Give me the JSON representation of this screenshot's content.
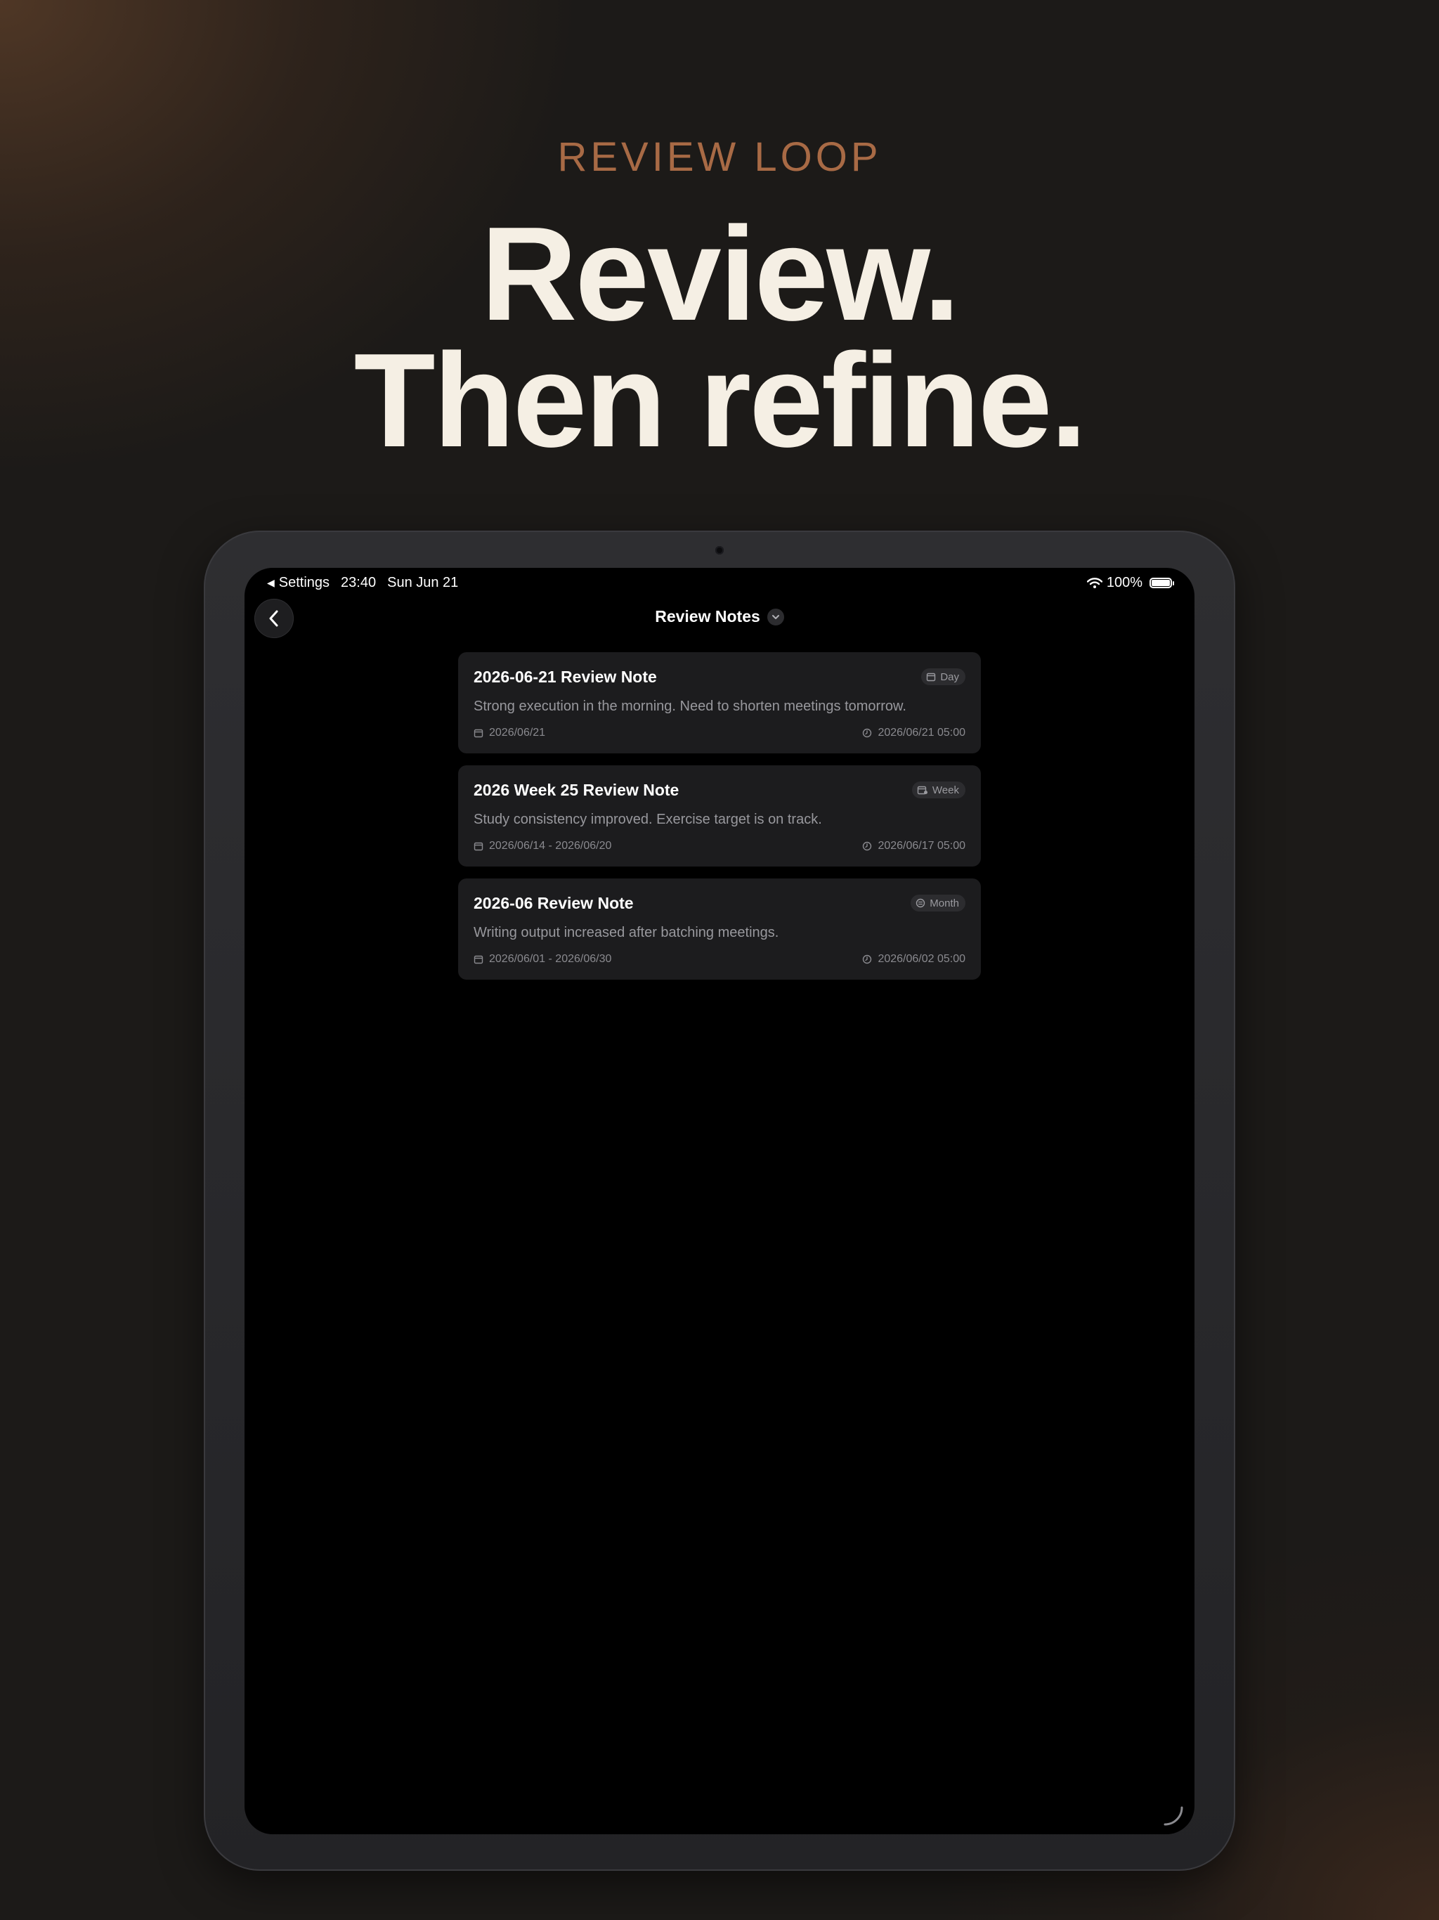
{
  "hero": {
    "eyebrow": "REVIEW LOOP",
    "line1": "Review.",
    "line2": "Then refine."
  },
  "status_bar": {
    "back_app": "Settings",
    "time": "23:40",
    "date": "Sun Jun 21",
    "battery": "100%"
  },
  "nav": {
    "title": "Review Notes"
  },
  "notes": [
    {
      "title": "2026-06-21 Review Note",
      "badge": "Day",
      "badge_icon": "calendar-day-icon",
      "summary": "Strong execution in the morning. Need to shorten meetings tomorrow.",
      "range": "2026/06/21",
      "created": "2026/06/21 05:00"
    },
    {
      "title": "2026 Week 25 Review Note",
      "badge": "Week",
      "badge_icon": "calendar-week-icon",
      "summary": "Study consistency improved. Exercise target is on track.",
      "range": "2026/06/14 - 2026/06/20",
      "created": "2026/06/17 05:00"
    },
    {
      "title": "2026-06 Review Note",
      "badge": "Month",
      "badge_icon": "calendar-month-icon",
      "summary": "Writing output increased after batching meetings.",
      "range": "2026/06/01 - 2026/06/30",
      "created": "2026/06/02 05:00"
    }
  ],
  "colors": {
    "accent": "#a86a45",
    "headline": "#f5efe4",
    "card_bg": "#1c1c1e",
    "screen_bg": "#000000"
  }
}
